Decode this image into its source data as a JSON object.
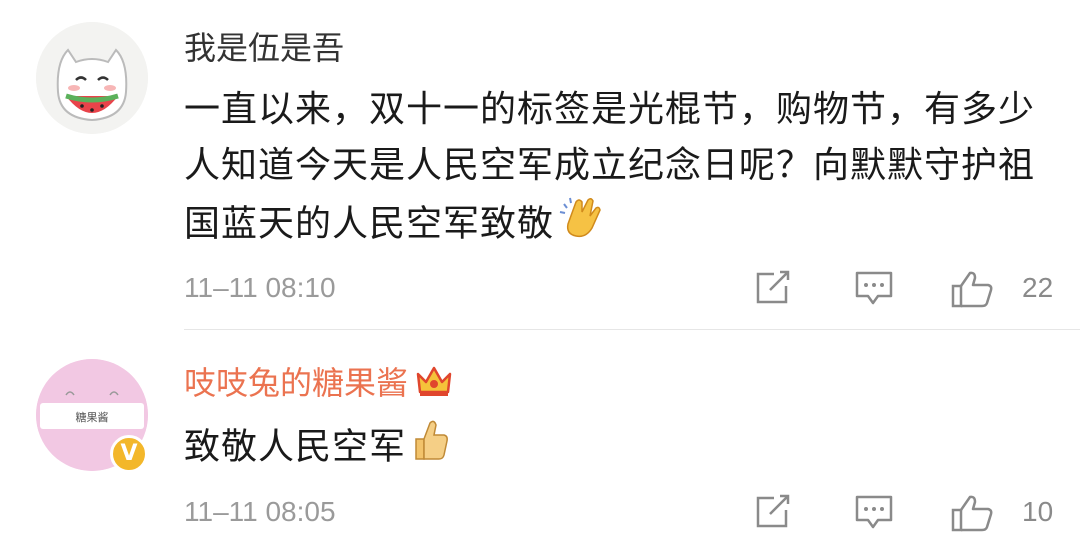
{
  "comments": [
    {
      "username": "我是伍是吾",
      "text": "一直以来，双十一的标签是光棍节，购物节，有多少人知道今天是人民空军成立纪念日呢？向默默守护祖国蓝天的人民空军致敬",
      "emoji": "clapping-hands-emoji",
      "time": "11–11 08:10",
      "likes": "22"
    },
    {
      "username": "吱吱兔的糖果酱",
      "text": "致敬人民空军",
      "emoji": "thumbs-up-emoji",
      "badge": "crown-badge",
      "verified": "V",
      "avatar_text": "糖果酱",
      "time": "11–11 08:05",
      "likes": "10"
    }
  ],
  "colors": {
    "username_default": "#333333",
    "username_vip": "#eb7350",
    "meta_gray": "#9a9a9a",
    "verified_badge": "#f3b72a"
  }
}
